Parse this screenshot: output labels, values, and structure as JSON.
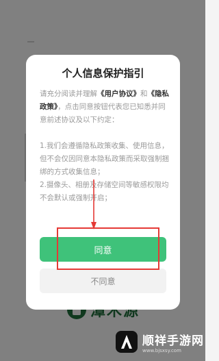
{
  "background": {
    "brand_name": "潭木源"
  },
  "dialog": {
    "title": "个人信息保护指引",
    "intro_1": "请充分阅读并理解",
    "link_user_agreement": "《用户协议》",
    "intro_2": "和",
    "link_privacy_policy": "《隐私政策》",
    "intro_3": "，点击同意按钮代表您已知悉并同意前述协议及以下约定：",
    "term_1": "1.我们会遵循隐私政策收集、使用信息，但不会仅因同意本隐私政策而采取强制捆绑的方式收集信息；",
    "term_2": "2.摄像头、相册及存储空间等敏感权限均不会默认或强制开启；",
    "agree_label": "同意",
    "disagree_label": "不同意"
  },
  "annotation": {
    "color": "#e53935"
  },
  "watermark": {
    "title": "顺祥手游网",
    "url": "www.bjsxsy.com"
  },
  "colors": {
    "agree_green": "#3fc27a",
    "brand_green": "#1f6b3a"
  }
}
